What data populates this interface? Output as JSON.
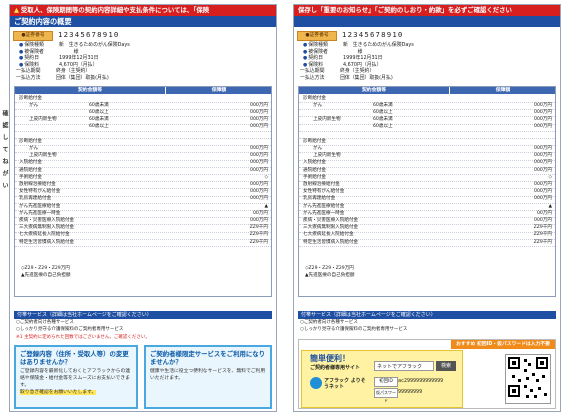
{
  "left": {
    "banner": "受取人、保険期間等の契約内容詳細や支払条件については、「保険",
    "section_title": "ご契約内容の概要",
    "number_label": "●証券番号",
    "number_value": "12345678910",
    "info": [
      {
        "label": "保険種類",
        "value": "新　生きるためのがん保険Days"
      },
      {
        "label": "被保険者",
        "value": "　　　様"
      },
      {
        "label": "契約日",
        "value": "1999年12月31日"
      },
      {
        "label": "保険料",
        "value": "4,670円（月払）"
      },
      {
        "label": "一払込期間",
        "value": "終身（主契約）"
      },
      {
        "label": "一払込方法",
        "value": "団体（集団）取扱(月払)"
      }
    ],
    "table_headers": [
      "契約金額等",
      "保障額"
    ],
    "rows": [
      {
        "label": "診断給付金",
        "indent": 0,
        "value": ""
      },
      {
        "label": "がん",
        "indent": 1,
        "sub": "60歳未満",
        "value": "000万円"
      },
      {
        "label": "",
        "indent": 1,
        "sub": "60歳以上",
        "value": "000万円"
      },
      {
        "label": "上皮内新生物",
        "indent": 1,
        "sub": "60歳未満",
        "value": "000万円"
      },
      {
        "label": "",
        "indent": 1,
        "sub": "60歳以上",
        "value": "000万円"
      },
      {
        "label": "",
        "indent": 0,
        "value": ""
      },
      {
        "label": "診断給付金",
        "indent": 0,
        "value": ""
      },
      {
        "label": "がん",
        "indent": 1,
        "value": "000万円"
      },
      {
        "label": "上皮内新生物",
        "indent": 1,
        "value": "000万円"
      },
      {
        "label": "入院給付金",
        "indent": 0,
        "value": "000万円"
      },
      {
        "label": "通院給付金",
        "indent": 0,
        "value": "000万円"
      },
      {
        "label": "手術給付金",
        "indent": 0,
        "value": "◇"
      },
      {
        "label": "放射線治療給付金",
        "indent": 0,
        "value": "000万円"
      },
      {
        "label": "女性特有がん給付金",
        "indent": 0,
        "value": "000万円"
      },
      {
        "label": "乳房再建給付金",
        "indent": 0,
        "value": "000万円"
      },
      {
        "label": "がん先進医療給付金",
        "indent": 0,
        "value": "▲"
      },
      {
        "label": "がん先進医療一時金",
        "indent": 0,
        "value": "00万円"
      },
      {
        "label": "疾病・災害医療入院給付金",
        "indent": 0,
        "value": "000万円"
      },
      {
        "label": "三大疾病無制限入院給付金",
        "indent": 0,
        "value": "ZZ9千円"
      },
      {
        "label": "七大疾病延長入院給付金",
        "indent": 0,
        "value": "ZZ9千円"
      },
      {
        "label": "特定生活習慣病入院給付金",
        "indent": 0,
        "value": "ZZ9千円"
      }
    ],
    "notes": [
      "◇Z29・Z29・Z29万円",
      "▲先進医療の自己負担額"
    ],
    "services_title": "付帯サービス（詳細は当社ホームページをご確認ください）",
    "services": [
      "○ご契約者向け各種サービス",
      "○しっかり見守る介護保険料のご契約者専用サービス"
    ],
    "footnote": "※1 主契約に定められた回数ではございません。ご確認ください。",
    "vertical_label": "確　認　し　て　ね　が　い",
    "panel1_title": "ご登録内容（住所・受取人等）の変更はありませんか？",
    "panel1_body": [
      "ご登録内容を最新化しておくとアフラックからの連絡や保険金・給付金等をスムーズにお支払いできます。",
      "取り急ぎ確認をお願いいたします。"
    ],
    "panel2_title": "ご契約者様限定サービスをご利用になりませんか？",
    "panel2_body": [
      "健康や生活に役立つ便利なサービスを、無料でご利用いただけます。"
    ]
  },
  "right": {
    "banner": "保存し「重要のお知らせ」「ご契約のしおり・約款」を必ずご確認ください",
    "section_title": "",
    "number_label": "●証券番号",
    "number_value": "12345678910",
    "info": [
      {
        "label": "保険種類",
        "value": "新　生きるためのがん保険Days"
      },
      {
        "label": "被保険者",
        "value": "　　　様"
      },
      {
        "label": "契約日",
        "value": "1999年12月31日"
      },
      {
        "label": "保険料",
        "value": "4,670円（月払）"
      },
      {
        "label": "一払込期間",
        "value": "終身（主契約）"
      },
      {
        "label": "一払込方法",
        "value": "団体（集団）取扱(月払)"
      }
    ],
    "table_headers": [
      "契約金額等",
      "保障額"
    ],
    "rows": [
      {
        "label": "診断給付金",
        "indent": 0,
        "value": ""
      },
      {
        "label": "がん",
        "indent": 1,
        "sub": "60歳未満",
        "value": "000万円"
      },
      {
        "label": "",
        "indent": 1,
        "sub": "60歳以上",
        "value": "000万円"
      },
      {
        "label": "上皮内新生物",
        "indent": 1,
        "sub": "60歳未満",
        "value": "000万円"
      },
      {
        "label": "",
        "indent": 1,
        "sub": "60歳以上",
        "value": "000万円"
      },
      {
        "label": "",
        "indent": 0,
        "value": ""
      },
      {
        "label": "診断給付金",
        "indent": 0,
        "value": ""
      },
      {
        "label": "がん",
        "indent": 1,
        "value": "000万円"
      },
      {
        "label": "上皮内新生物",
        "indent": 1,
        "value": "000万円"
      },
      {
        "label": "入院給付金",
        "indent": 0,
        "value": "000万円"
      },
      {
        "label": "通院給付金",
        "indent": 0,
        "value": "000万円"
      },
      {
        "label": "手術給付金",
        "indent": 0,
        "value": "◇"
      },
      {
        "label": "放射線治療給付金",
        "indent": 0,
        "value": "000万円"
      },
      {
        "label": "女性特有がん給付金",
        "indent": 0,
        "value": "000万円"
      },
      {
        "label": "乳房再建給付金",
        "indent": 0,
        "value": "000万円"
      },
      {
        "label": "がん先進医療給付金",
        "indent": 0,
        "value": "▲"
      },
      {
        "label": "がん先進医療一時金",
        "indent": 0,
        "value": "00万円"
      },
      {
        "label": "疾病・災害医療入院給付金",
        "indent": 0,
        "value": "000万円"
      },
      {
        "label": "三大疾病無制限入院給付金",
        "indent": 0,
        "value": "ZZ9千円"
      },
      {
        "label": "七大疾病延長入院給付金",
        "indent": 0,
        "value": "ZZ9千円"
      },
      {
        "label": "特定生活習慣病入院給付金",
        "indent": 0,
        "value": "ZZ9千円"
      }
    ],
    "notes": [
      "◇Z29・Z29・Z29万円",
      "▲先進医療の自己負担額"
    ],
    "services_title": "付帯サービス（詳細は当社ホームページをご確認ください）",
    "services": [
      "○ご契約者向け各種サービス",
      "○しっかり見守る介護保険料のご契約者専用サービス"
    ],
    "promo_tag": "おすすめ 初回ID・仮パスワードは入力不要",
    "promo_title": "簡単便利！",
    "promo_sub": "ご契約者様専用サイト",
    "search_placeholder": "ネットでアフラック",
    "search_button": "検索",
    "logo_text": "アフラック よりそうネット",
    "id_label": "初回ID",
    "id_value": "ac2999999999999",
    "pw_label": "仮パスワード",
    "pw_value": "99999999",
    "qr_label": "QRコード"
  },
  "colors": {
    "banner": "#d81f1f",
    "title": "#1f4fa3",
    "header": "#3d67b1",
    "accent": "#f0b64e",
    "panel": "#4aa8e0"
  }
}
